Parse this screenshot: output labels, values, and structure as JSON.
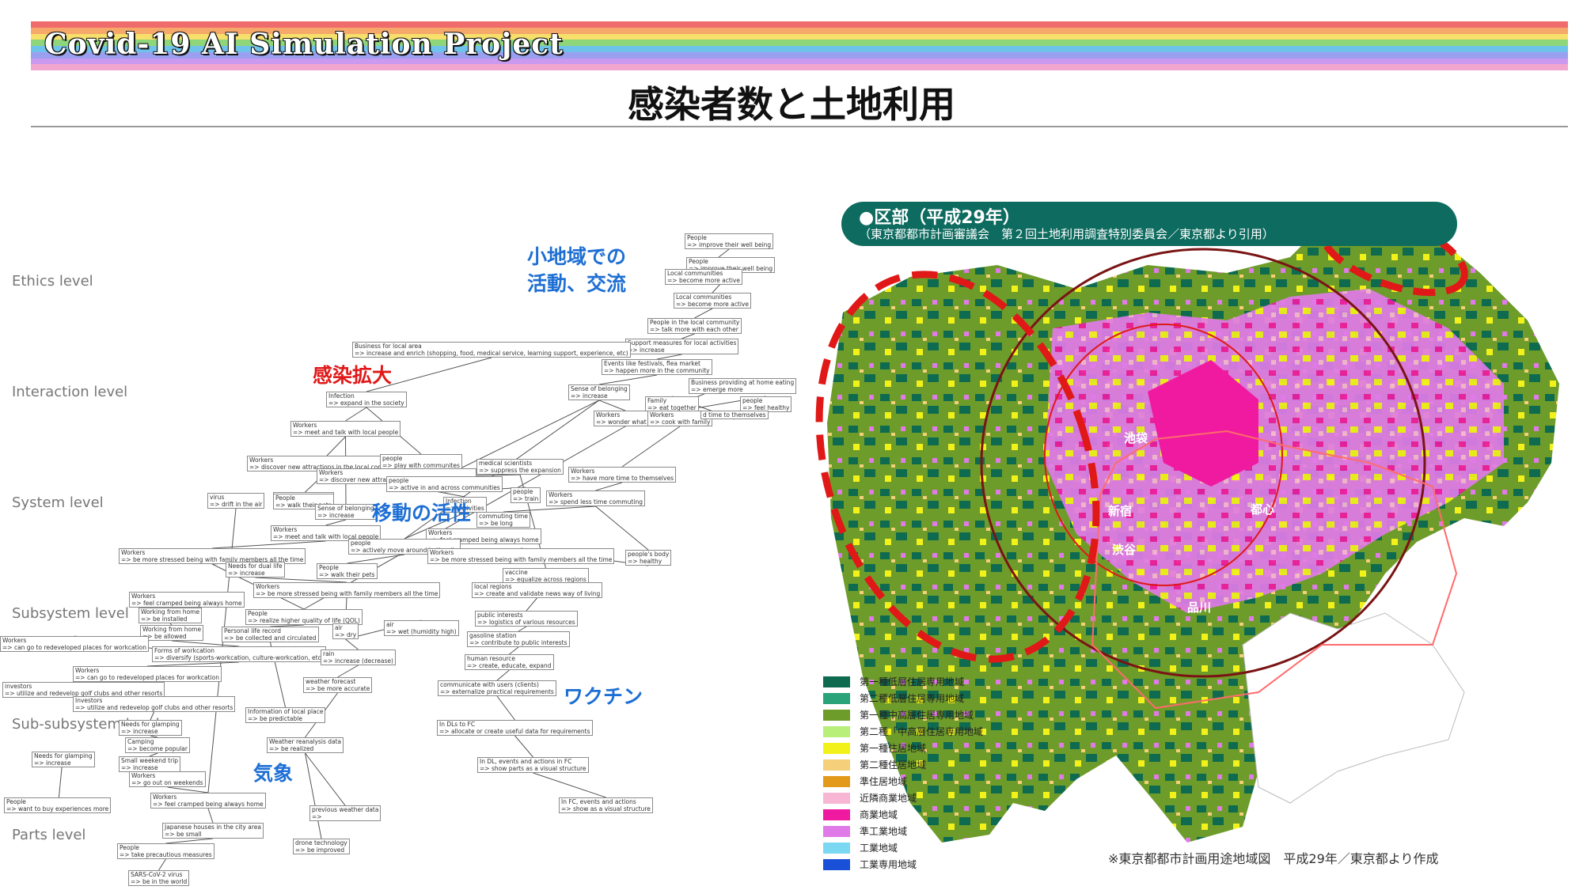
{
  "header": {
    "project_title": "Covid-19 AI Simulation Project",
    "slide_title": "感染者数と土地利用",
    "rainbow_colors": [
      "#f06b6b",
      "#f5a86a",
      "#f6df6a",
      "#8fd67a",
      "#6fc3ea",
      "#9a9ff0",
      "#c99af0",
      "#f2a6cf"
    ]
  },
  "levels": [
    "Ethics level",
    "Interaction level",
    "System level",
    "Subsystem level",
    "Sub-subsystem level",
    "Parts level"
  ],
  "annotations": {
    "small_area": [
      "小地域での",
      "活動、交流"
    ],
    "infection_spread": "感染拡大",
    "mobility": "移動の活性",
    "vaccine": "ワクチン",
    "weather": "気象"
  },
  "nodes": [
    {
      "t": "People",
      "v": "=> improve their well being"
    },
    {
      "t": "People",
      "v": "=> improve their well being"
    },
    {
      "t": "Local communities",
      "v": "=> become more active"
    },
    {
      "t": "Local communities",
      "v": "=> become more active"
    },
    {
      "t": "People in the local community",
      "v": "=> talk more with each other"
    },
    {
      "t": "Support measures for local activities",
      "v": "=> increase"
    },
    {
      "t": "Business for local area",
      "v": "=> increase and enrich (shopping, food, medical service, learning support, experience, etc)"
    },
    {
      "t": "Events like festivals, flea market",
      "v": "=> happen more in the community"
    },
    {
      "t": "Business providing at home eating",
      "v": "=> emerge more"
    },
    {
      "t": "Sense of belonging",
      "v": "=> increase"
    },
    {
      "t": "Family",
      "v": "=> eat together"
    },
    {
      "t": "people",
      "v": "=> feel healthy"
    },
    {
      "t": "Workers",
      "v": "=> wonder what to"
    },
    {
      "t": "Workers",
      "v": "=> cook with family"
    },
    {
      "t": "",
      "v": "d time to themselves"
    },
    {
      "t": "Infection",
      "v": "=> expand in the society"
    },
    {
      "t": "Workers",
      "v": "=> meet and talk with local people"
    },
    {
      "t": "Workers",
      "v": "=> discover new attractions in the local community"
    },
    {
      "t": "People",
      "v": "=> walk their pets"
    },
    {
      "t": "people",
      "v": "=> play with communites"
    },
    {
      "t": "Workers",
      "v": "=> discover new attractions in the local community"
    },
    {
      "t": "medical scientists",
      "v": "=> suppress the expansion"
    },
    {
      "t": "Workers",
      "v": "=> have more time to themselves"
    },
    {
      "t": "people",
      "v": "=> active in and across communities"
    },
    {
      "t": "people",
      "v": "=> train"
    },
    {
      "t": "Workers",
      "v": "=> spend less time commuting"
    },
    {
      "t": "virus",
      "v": "=> drift in the air"
    },
    {
      "t": "People",
      "v": "=> walk their pets"
    },
    {
      "t": "Sense of belonging",
      "v": "=> increase"
    },
    {
      "t": "Infection",
      "v": "=> activities"
    },
    {
      "t": "commuting time",
      "v": "=> be long"
    },
    {
      "t": "Workers",
      "v": "=> meet and talk with local people"
    },
    {
      "t": "Workers",
      "v": "=> feel cramped being always home"
    },
    {
      "t": "people",
      "v": "=> actively move around in the city"
    },
    {
      "t": "Workers",
      "v": "=> be more stressed being with family members all the time"
    },
    {
      "t": "Workers",
      "v": "=> be more stressed being with family members all the time"
    },
    {
      "t": "people's body",
      "v": "=> healthy"
    },
    {
      "t": "Needs for dual life",
      "v": "=> increase"
    },
    {
      "t": "People",
      "v": "=> walk their pets"
    },
    {
      "t": "vaccine",
      "v": "=> equalize across regions"
    },
    {
      "t": "Workers",
      "v": "=> be more stressed being with family members all the time"
    },
    {
      "t": "local regions",
      "v": "=> create and validate news way of living"
    },
    {
      "t": "Workers",
      "v": "=> feel cramped being always home"
    },
    {
      "t": "Working from home",
      "v": "=> be installed"
    },
    {
      "t": "People",
      "v": "=> realize higher quality of life (QOL)"
    },
    {
      "t": "public interests",
      "v": "=> logistics of various resources"
    },
    {
      "t": "Working from home",
      "v": "=> be allowed"
    },
    {
      "t": "Personal life record",
      "v": "=> be collected and circulated"
    },
    {
      "t": "air",
      "v": "=> dry"
    },
    {
      "t": "air",
      "v": "=> wet (humidity high)"
    },
    {
      "t": "gasoline station",
      "v": "=> contribute to public interests"
    },
    {
      "t": "Workers",
      "v": "=> can go to redeveloped places for workcation"
    },
    {
      "t": "Forms of workcation",
      "v": "=> diversify (sports-workcation, culture-workcation, etc)"
    },
    {
      "t": "rain",
      "v": "=> increase (decrease)"
    },
    {
      "t": "human resource",
      "v": "=> create, educate, expand"
    },
    {
      "t": "Workers",
      "v": "=> can go to redeveloped places for workcation"
    },
    {
      "t": "weather forecast",
      "v": "=> be more accurate"
    },
    {
      "t": "investors",
      "v": "=> utilize and redevelop golf clubs and other resorts"
    },
    {
      "t": "communicate with users (clients)",
      "v": "=> externalize practical requirements"
    },
    {
      "t": "Investors",
      "v": "=> utilize and redevelop golf clubs and other resorts"
    },
    {
      "t": "Information of local place",
      "v": "=> be predictable"
    },
    {
      "t": "Needs for glamping",
      "v": "=> increase"
    },
    {
      "t": "In DLs to FC",
      "v": "=> allocate or create useful data for requirements"
    },
    {
      "t": "Camping",
      "v": "=> become popular"
    },
    {
      "t": "Weather reanalysis data",
      "v": "=> be realized"
    },
    {
      "t": "Needs for glamping",
      "v": "=> increase"
    },
    {
      "t": "In DL, events and actions in FC",
      "v": "=> show parts as a visual structure"
    },
    {
      "t": "Small weekend trip",
      "v": "=> increase"
    },
    {
      "t": "Workers",
      "v": "=> go out on weekends"
    },
    {
      "t": "People",
      "v": "=> want to buy experiences more"
    },
    {
      "t": "Workers",
      "v": "=> feel cramped being always home"
    },
    {
      "t": "In FC, events and actions",
      "v": "=> show as a visual structure"
    },
    {
      "t": "previous weather data",
      "v": "=>"
    },
    {
      "t": "Japanese houses in the city area",
      "v": "=> be small"
    },
    {
      "t": "drone technology",
      "v": "=> be improved"
    },
    {
      "t": "People",
      "v": "=> take precautious measures"
    },
    {
      "t": "SARS-CoV-2 virus",
      "v": "=> be in the world"
    }
  ],
  "map": {
    "banner_title": "●区部（平成29年）",
    "banner_sub": "（東京都都市計画審議会　第２回土地利用調査特別委員会／東京都より引用）",
    "places": [
      "池袋",
      "新宿",
      "都心",
      "渋谷",
      "品川"
    ],
    "note": "※東京都都市計画用途地域図　平成29年／東京都より作成",
    "legend": [
      {
        "label": "第一種低層住居専用地域",
        "color": "#0e6b4f"
      },
      {
        "label": "第二種低層住居専用地域",
        "color": "#2aa27a"
      },
      {
        "label": "第一種中高層住居専用地域",
        "color": "#6e9c2a"
      },
      {
        "label": "第二種「中高層住居専用地域",
        "color": "#b8ee7a"
      },
      {
        "label": "第一種住居地域",
        "color": "#f2f21a"
      },
      {
        "label": "第二種住居地域",
        "color": "#f5cf7a"
      },
      {
        "label": "準住居地域",
        "color": "#e39a1a"
      },
      {
        "label": "近隣商業地域",
        "color": "#f7b6d4"
      },
      {
        "label": "商業地域",
        "color": "#f01aa0"
      },
      {
        "label": "準工業地域",
        "color": "#e07ae8"
      },
      {
        "label": "工業地域",
        "color": "#7ad8f2"
      },
      {
        "label": "工業専用地域",
        "color": "#1a4fd8"
      }
    ]
  }
}
